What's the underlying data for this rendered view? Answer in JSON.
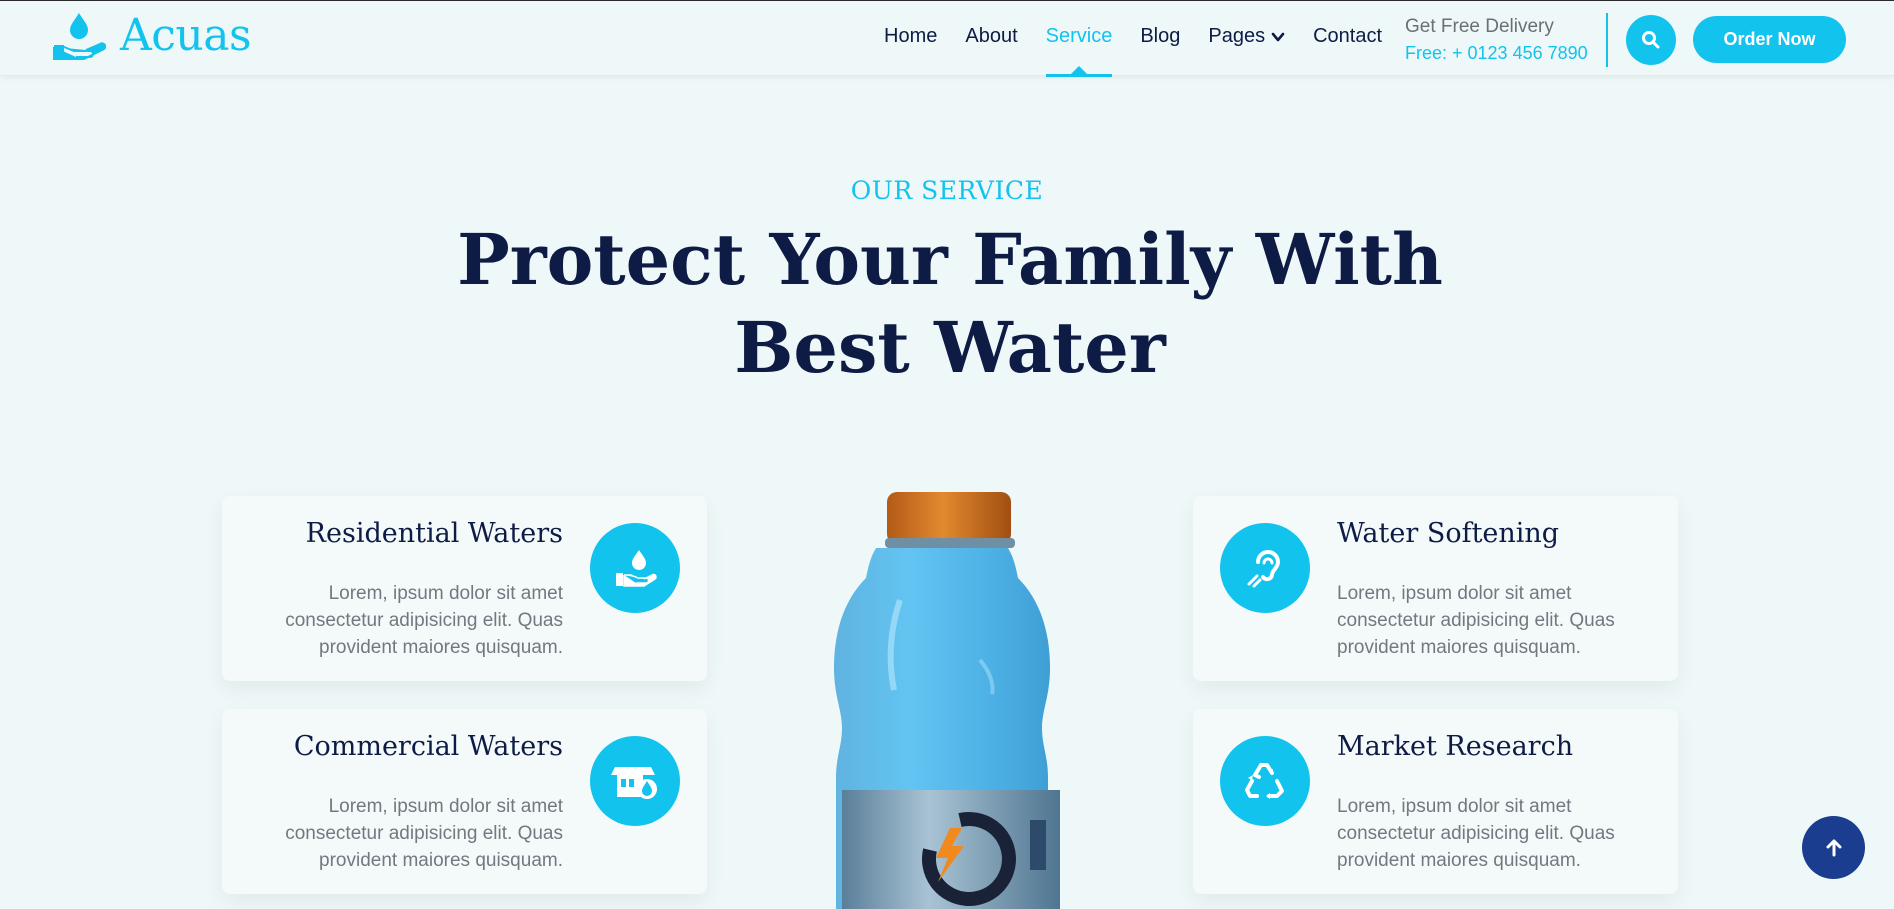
{
  "header": {
    "logo_text": "Acuas",
    "logo_icon": "hand-water-drop-icon",
    "nav": [
      {
        "label": "Home"
      },
      {
        "label": "About"
      },
      {
        "label": "Service",
        "active": true
      },
      {
        "label": "Blog"
      },
      {
        "label": "Pages",
        "has_dropdown": true
      },
      {
        "label": "Contact"
      }
    ],
    "contact_label": "Get Free Delivery",
    "contact_phone": "Free: + 0123 456 7890",
    "search_icon": "search-icon",
    "order_button": "Order Now"
  },
  "section": {
    "subtitle": "OUR SERVICE",
    "title_line1": "Protect Your Family With",
    "title_line2": "Best Water"
  },
  "services": [
    {
      "title": "Residential Waters",
      "text": "Lorem, ipsum dolor sit amet consectetur adipisicing elit. Quas provident maiores quisquam.",
      "icon": "hand-water-icon"
    },
    {
      "title": "Water Softening",
      "text": "Lorem, ipsum dolor sit amet consectetur adipisicing elit. Quas provident maiores quisquam.",
      "icon": "ear-icon"
    },
    {
      "title": "Commercial Waters",
      "text": "Lorem, ipsum dolor sit amet consectetur adipisicing elit. Quas provident maiores quisquam.",
      "icon": "water-store-icon"
    },
    {
      "title": "Market Research",
      "text": "Lorem, ipsum dolor sit amet consectetur adipisicing elit. Quas provident maiores quisquam.",
      "icon": "recycle-icon"
    }
  ],
  "bottle_image": "water-bottle-image",
  "back_to_top_icon": "arrow-up-icon",
  "colors": {
    "accent": "#12c3ee",
    "navy": "#0d1b45",
    "background": "#eff8f8",
    "back_to_top": "#1a3d8f"
  }
}
